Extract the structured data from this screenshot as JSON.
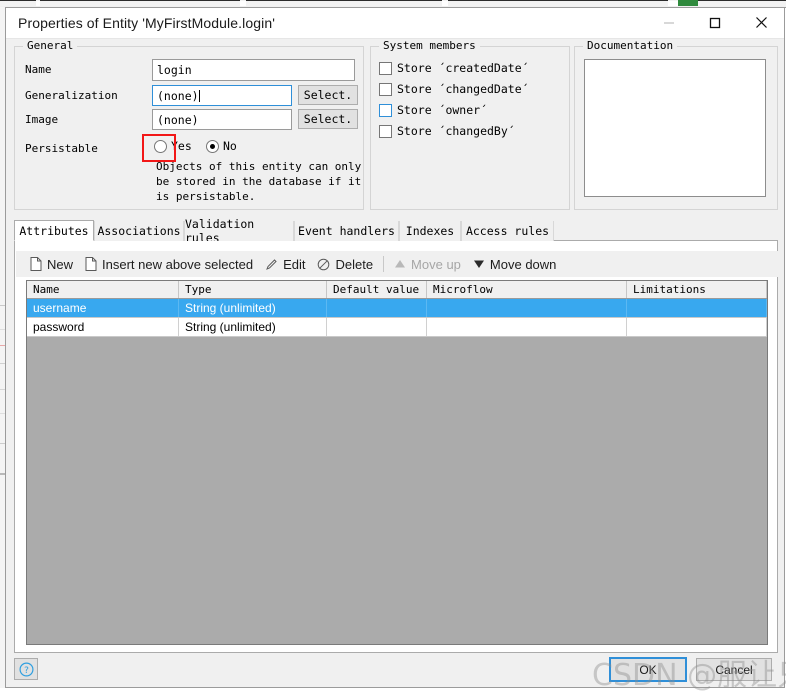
{
  "window": {
    "title": "Properties of Entity 'MyFirstModule.login'",
    "controls": {
      "minimize": "minimize-icon",
      "maximize": "maximize-icon",
      "close": "close-icon"
    }
  },
  "general": {
    "legend": "General",
    "name_label": "Name",
    "name_value": "login",
    "generalization_label": "Generalization",
    "generalization_value": "(none)",
    "generalization_select": "Select.",
    "image_label": "Image",
    "image_value": "(none)",
    "image_select": "Select.",
    "persistable_label": "Persistable",
    "persistable_yes": "Yes",
    "persistable_no": "No",
    "persistable_selected": "No",
    "persistable_description": "Objects of this entity can only\nbe stored in the database if it\nis persistable."
  },
  "system_members": {
    "legend": "System members",
    "items": [
      {
        "label": "Store ´createdDate´",
        "checked": false,
        "focused": false
      },
      {
        "label": "Store ´changedDate´",
        "checked": false,
        "focused": false
      },
      {
        "label": "Store ´owner´",
        "checked": false,
        "focused": true
      },
      {
        "label": "Store ´changedBy´",
        "checked": false,
        "focused": false
      }
    ]
  },
  "documentation": {
    "legend": "Documentation",
    "value": "",
    "scroll_up": "scroll-up-icon",
    "scroll_down": "scroll-down-icon"
  },
  "tabs": {
    "active": "Attributes",
    "items": [
      {
        "label": "Attributes"
      },
      {
        "label": "Associations"
      },
      {
        "label": "Validation rules"
      },
      {
        "label": "Event handlers"
      },
      {
        "label": "Indexes"
      },
      {
        "label": "Access rules"
      }
    ]
  },
  "toolbar": {
    "new_label": "New",
    "insert_label": "Insert new above selected",
    "edit_label": "Edit",
    "delete_label": "Delete",
    "move_up_label": "Move up",
    "move_down_label": "Move down"
  },
  "grid": {
    "columns": [
      "Name",
      "Type",
      "Default value",
      "Microflow",
      "Limitations"
    ],
    "rows": [
      {
        "cells": [
          "username",
          "String (unlimited)",
          "",
          "",
          ""
        ],
        "selected": true
      },
      {
        "cells": [
          "password",
          "String (unlimited)",
          "",
          "",
          ""
        ],
        "selected": false
      }
    ]
  },
  "footer": {
    "help_label": "?",
    "ok_label": "OK",
    "cancel_label": "Cancel"
  },
  "watermark": {
    "text": "CSDN @服让只有码"
  },
  "colors": {
    "selection_blue": "#38a8ef",
    "focus_blue": "#2f8fd8",
    "annotation_red": "#f21717",
    "dialog_bg": "#f0f0f0",
    "grid_empty_bg": "#ababab"
  }
}
